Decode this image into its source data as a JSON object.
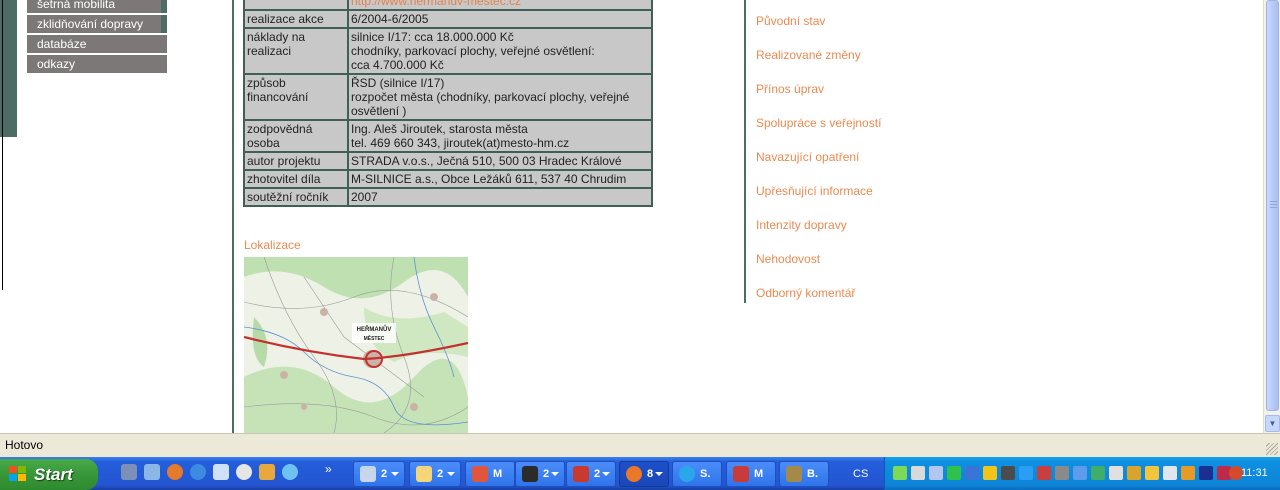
{
  "left_nav": [
    {
      "label": "šetrná mobilita"
    },
    {
      "label": "zklidňování dopravy"
    },
    {
      "label": "databáze"
    },
    {
      "label": "odkazy"
    }
  ],
  "info_table": {
    "top_link": "http://www.hermanuv-mestec.cz",
    "rows": [
      {
        "key": "realizace akce",
        "value": [
          "6/2004-6/2005"
        ]
      },
      {
        "key": "náklady na realizaci",
        "value": [
          "silnice I/17: cca 18.000.000 Kč",
          "chodníky, parkovací plochy, veřejné osvětlení:",
          "cca 4.700.000 Kč"
        ]
      },
      {
        "key": "způsob financování",
        "value": [
          "ŘSD (silnice I/17)",
          "rozpočet města (chodníky, parkovací plochy, veřejné osvětlení )"
        ]
      },
      {
        "key": "zodpovědná osoba",
        "value": [
          "Ing. Aleš Jiroutek, starosta města",
          "tel. 469 660 343, jiroutek(at)mesto-hm.cz"
        ]
      },
      {
        "key": "autor projektu",
        "value": [
          "STRADA v.o.s., Ječná 510, 500 03 Hradec Králové"
        ]
      },
      {
        "key": "zhotovitel díla",
        "value": [
          "M-SILNICE a.s., Obce Ležáků 611, 537 40 Chrudim"
        ]
      },
      {
        "key": "soutěžní ročník",
        "value": [
          "2007"
        ]
      }
    ]
  },
  "location": {
    "label": "Lokalizace",
    "map_text_1": "HEŘMANŮV",
    "map_text_2": "MĚSTEC"
  },
  "right_nav": [
    {
      "label": "Původní stav"
    },
    {
      "label": "Realizované změny"
    },
    {
      "label": "Přínos úprav"
    },
    {
      "label": "Spolupráce s veřejností"
    },
    {
      "label": "Navazující opatření"
    },
    {
      "label": "Upřesňující informace"
    },
    {
      "label": "Intenzity dopravy"
    },
    {
      "label": "Nehodovost"
    },
    {
      "label": "Odborný komentář"
    }
  ],
  "status_bar": {
    "text": "Hotovo"
  },
  "taskbar": {
    "start_label": "Start",
    "quick_launch_more": "»",
    "buttons": [
      {
        "label": "2",
        "icon": "printer-icon",
        "color": "#c8d6ec",
        "grouped": true
      },
      {
        "label": "2",
        "icon": "folder-icon",
        "color": "#f3d67a",
        "grouped": true
      },
      {
        "label": "M",
        "icon": "mail-icon",
        "color": "#e0563d",
        "grouped": false
      },
      {
        "label": "2",
        "icon": "terminal-icon",
        "color": "#2b2b2b",
        "grouped": true
      },
      {
        "label": "2",
        "icon": "pdf-icon",
        "color": "#c8392f",
        "grouped": true
      },
      {
        "label": "8",
        "icon": "firefox-icon",
        "color": "#e9782a",
        "grouped": true
      },
      {
        "label": "S.",
        "icon": "skype-icon",
        "color": "#28a8ea",
        "grouped": false
      },
      {
        "label": "M",
        "icon": "mail-icon",
        "color": "#c83b3b",
        "grouped": false
      },
      {
        "label": "B.",
        "icon": "app-icon",
        "color": "#a48a4a",
        "grouped": false
      }
    ],
    "language": "CS",
    "clock": "11:31"
  }
}
